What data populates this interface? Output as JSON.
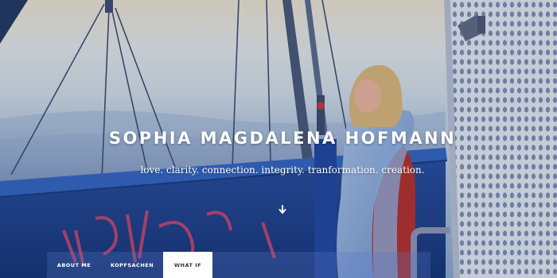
{
  "hero": {
    "title": "SOPHIA MAGDALENA HOFMANN",
    "tagline": "love. clarity. connection. integrity. tranformation. creation."
  },
  "nav": {
    "tabs": [
      {
        "label": "ABOUT ME",
        "active": false
      },
      {
        "label": "KOPFSACHEN",
        "active": false
      },
      {
        "label": "WHAT IF",
        "active": true
      }
    ]
  },
  "colors": {
    "nav_bar": "#5a78c8",
    "active_tab": "#ffffff",
    "title_text": "#ffffff"
  },
  "icons": {
    "scroll": "arrow-down-icon"
  }
}
